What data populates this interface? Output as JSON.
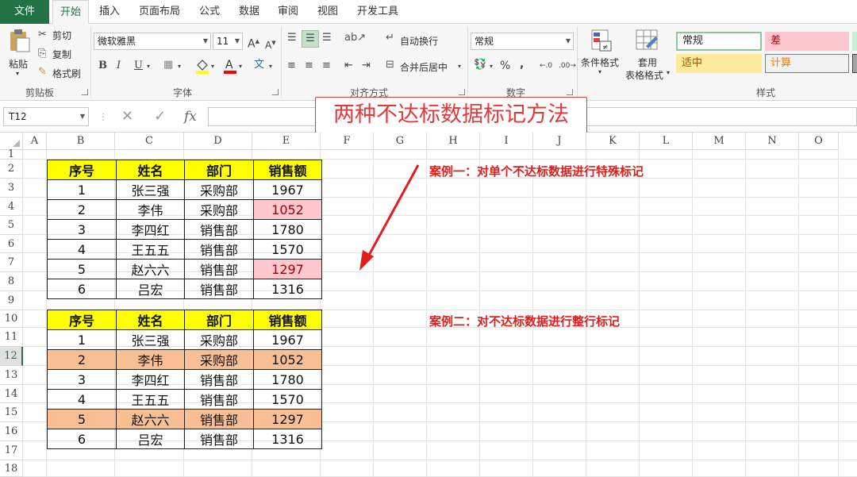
{
  "tabs": [
    "文件",
    "开始",
    "插入",
    "页面布局",
    "公式",
    "数据",
    "审阅",
    "视图",
    "开发工具"
  ],
  "active_tab": "开始",
  "ribbon": {
    "clipboard": {
      "paste": "粘贴",
      "cut": "剪切",
      "copy": "复制",
      "format_painter": "格式刷",
      "group_label": "剪贴板"
    },
    "font": {
      "font_name": "微软雅黑",
      "font_size": "11",
      "bold": "B",
      "italic": "I",
      "underline": "U",
      "group_label": "字体"
    },
    "alignment": {
      "wrap_text": "自动换行",
      "merge_center": "合并后居中",
      "group_label": "对齐方式"
    },
    "number": {
      "format": "常规",
      "percent": "%",
      "comma": ",",
      "group_label": "数字"
    },
    "styles": {
      "conditional_format": "条件格式",
      "table_format_line1": "套用",
      "table_format_line2": "表格格式",
      "cell_styles": [
        "常规",
        "差",
        "适中",
        "计算"
      ],
      "group_label": "样式"
    }
  },
  "formula_bar": {
    "name_box": "T12",
    "fx": "fx",
    "cancel": "✕",
    "enter": "✓"
  },
  "callout_title": "两种不达标数据标记方法",
  "columns": [
    "A",
    "B",
    "C",
    "D",
    "E",
    "F",
    "G",
    "H",
    "I",
    "J",
    "K",
    "L",
    "M",
    "N",
    "O"
  ],
  "rows": [
    "1",
    "2",
    "3",
    "4",
    "5",
    "6",
    "7",
    "8",
    "9",
    "10",
    "11",
    "12",
    "13",
    "14",
    "15",
    "16",
    "17",
    "18"
  ],
  "selected_row": "12",
  "table_headers": [
    "序号",
    "姓名",
    "部门",
    "销售额"
  ],
  "table1": [
    [
      "1",
      "张三强",
      "采购部",
      "1967"
    ],
    [
      "2",
      "李伟",
      "采购部",
      "1052"
    ],
    [
      "3",
      "李四红",
      "销售部",
      "1780"
    ],
    [
      "4",
      "王五五",
      "销售部",
      "1570"
    ],
    [
      "5",
      "赵六六",
      "销售部",
      "1297"
    ],
    [
      "6",
      "吕宏",
      "销售部",
      "1316"
    ]
  ],
  "table2": [
    [
      "1",
      "张三强",
      "采购部",
      "1967"
    ],
    [
      "2",
      "李伟",
      "采购部",
      "1052"
    ],
    [
      "3",
      "李四红",
      "销售部",
      "1780"
    ],
    [
      "4",
      "王五五",
      "销售部",
      "1570"
    ],
    [
      "5",
      "赵六六",
      "销售部",
      "1297"
    ],
    [
      "6",
      "吕宏",
      "销售部",
      "1316"
    ]
  ],
  "case1": "案例一：对单个不达标数据进行特殊标记",
  "case2": "案例二：对不达标数据进行整行标记",
  "colors": {
    "excel_green": "#217346",
    "header_yellow": "#ffff00",
    "bad_pink": "#ffc7ce",
    "row_orange": "#f8bf94",
    "annotation_red": "#e01e1e"
  }
}
